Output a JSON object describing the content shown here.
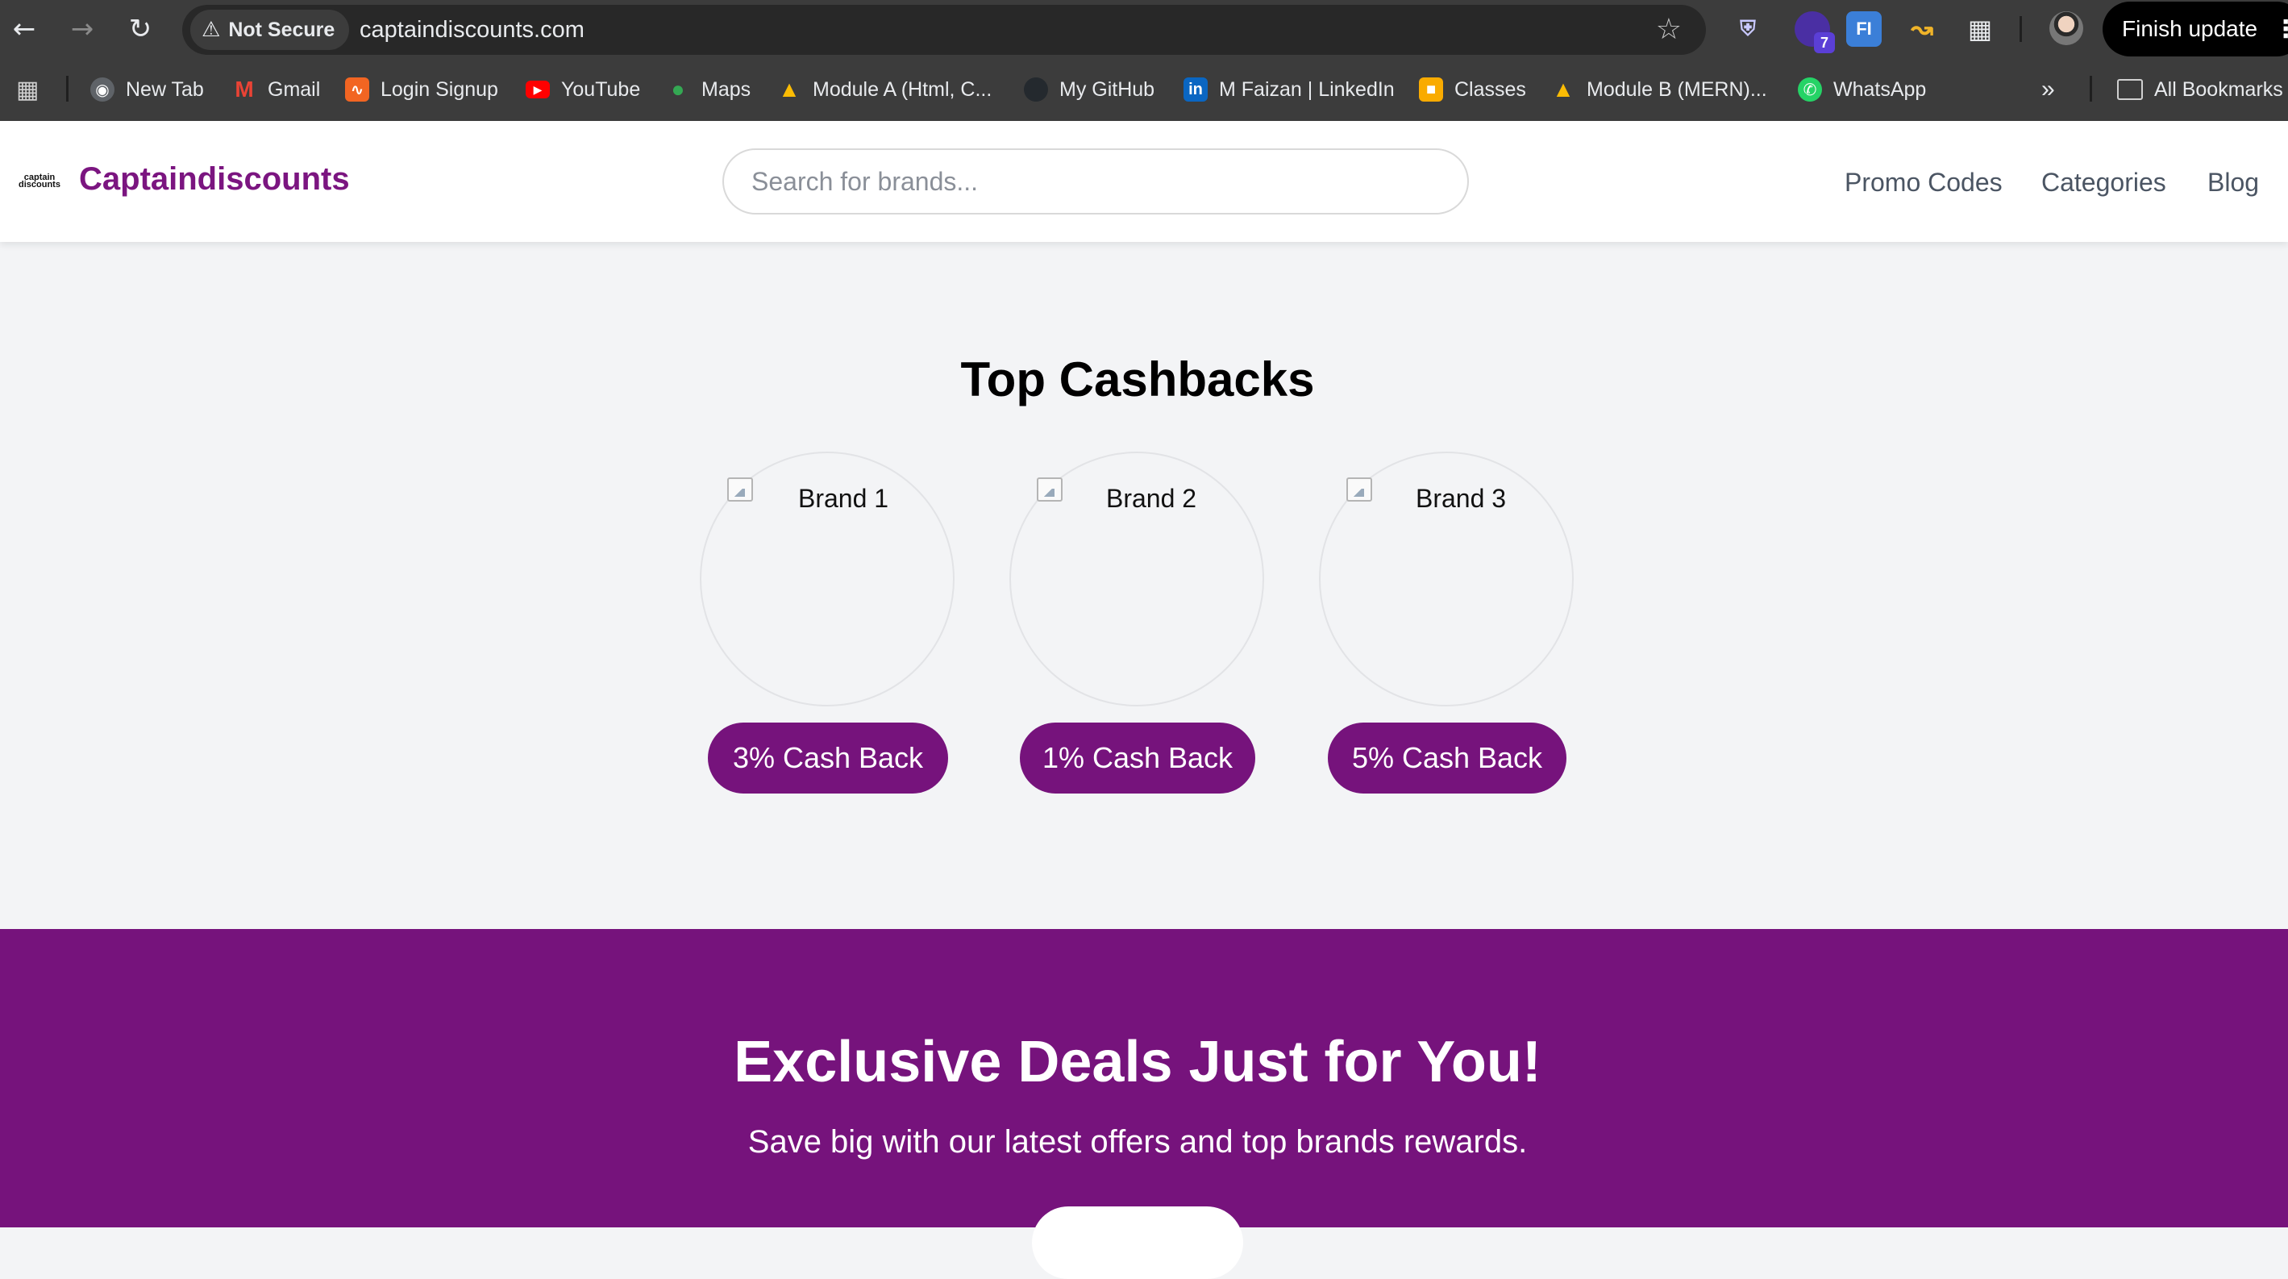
{
  "browser": {
    "security_label": "Not Secure",
    "url": "captaindiscounts.com",
    "extension_badge": "7",
    "finish_update_label": "Finish update",
    "bookmarks": [
      {
        "label": "New Tab",
        "icon": "globe-icon"
      },
      {
        "label": "Gmail",
        "icon": "gmail-icon"
      },
      {
        "label": "Login Signup",
        "icon": "login-signup-icon"
      },
      {
        "label": "YouTube",
        "icon": "youtube-icon"
      },
      {
        "label": "Maps",
        "icon": "maps-icon"
      },
      {
        "label": "Module A (Html, C...",
        "icon": "google-drive-icon"
      },
      {
        "label": "My GitHub",
        "icon": "github-icon"
      },
      {
        "label": "M Faizan | LinkedIn",
        "icon": "linkedin-icon"
      },
      {
        "label": "Classes",
        "icon": "classroom-icon"
      },
      {
        "label": "Module B (MERN)...",
        "icon": "google-drive-icon"
      },
      {
        "label": "WhatsApp",
        "icon": "whatsapp-icon"
      }
    ],
    "all_bookmarks_label": "All Bookmarks"
  },
  "site": {
    "logo_mark": "captain discounts",
    "brand_name": "Captaindiscounts",
    "search_placeholder": "Search for brands...",
    "nav": [
      "Promo Codes",
      "Categories",
      "Blog"
    ]
  },
  "top_cashbacks": {
    "title": "Top Cashbacks",
    "brands": [
      {
        "alt": "Brand 1",
        "cashback": "3% Cash Back"
      },
      {
        "alt": "Brand 2",
        "cashback": "1% Cash Back"
      },
      {
        "alt": "Brand 3",
        "cashback": "5% Cash Back"
      }
    ]
  },
  "deals": {
    "title": "Exclusive Deals Just for You!",
    "subtitle": "Save big with our latest offers and top brands rewards."
  },
  "colors": {
    "brand_purple": "#76137c",
    "chrome_dark": "#3c3c3c",
    "page_bg": "#f3f4f6"
  }
}
